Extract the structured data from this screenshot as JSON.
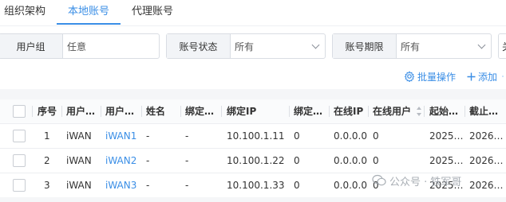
{
  "tabs": [
    {
      "label": "组织架构"
    },
    {
      "label": "本地账号"
    },
    {
      "label": "代理账号"
    }
  ],
  "filters": {
    "user_group": {
      "label": "用户组",
      "value": "任意"
    },
    "account_status": {
      "label": "账号状态",
      "value": "所有"
    },
    "account_period": {
      "label": "账号期限",
      "value": "所有"
    },
    "next_partial": "关"
  },
  "actions": {
    "batch": "批量操作",
    "add": "添加"
  },
  "table": {
    "headers": [
      "序号",
      "用户…",
      "用户…",
      "姓名",
      "绑定…",
      "绑定IP",
      "绑定…",
      "在线IP",
      "在线用户",
      "起始…",
      "截止…"
    ],
    "rows": [
      {
        "index": "1",
        "group": "iWAN",
        "user": "iWAN1",
        "name": "-",
        "bind_type": "-",
        "bind_ip": "10.100.1.11",
        "bind_count": "0",
        "online_ip": "0.0.0.0",
        "online_user": "0",
        "start": "2025…",
        "end": "2026…"
      },
      {
        "index": "2",
        "group": "iWAN",
        "user": "iWAN2",
        "name": "-",
        "bind_type": "-",
        "bind_ip": "10.100.1.22",
        "bind_count": "0",
        "online_ip": "0.0.0.0",
        "online_user": "0",
        "start": "2025…",
        "end": "2026…"
      },
      {
        "index": "3",
        "group": "iWAN",
        "user": "iWAN3",
        "name": "-",
        "bind_type": "-",
        "bind_ip": "10.100.1.33",
        "bind_count": "0",
        "online_ip": "0.0.0.0",
        "online_user": "0",
        "start": "2025…",
        "end": "2026…"
      }
    ]
  },
  "watermark": "公众号 · 铁军哥",
  "colors": {
    "accent": "#3a8ee6",
    "border": "#d9dde3",
    "label_bg": "#f2f4f7"
  }
}
